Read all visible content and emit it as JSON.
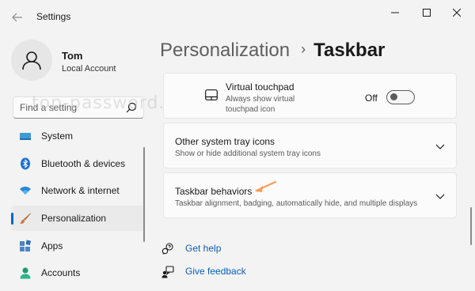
{
  "window": {
    "title": "Settings",
    "controls": [
      "minimize",
      "maximize",
      "close"
    ]
  },
  "profile": {
    "name": "Tom",
    "account_type": "Local Account"
  },
  "search": {
    "placeholder": "Find a setting"
  },
  "sidebar": {
    "items": [
      {
        "label": "System",
        "icon": "display-icon",
        "active": false
      },
      {
        "label": "Bluetooth & devices",
        "icon": "bluetooth-icon",
        "active": false
      },
      {
        "label": "Network & internet",
        "icon": "wifi-icon",
        "active": false
      },
      {
        "label": "Personalization",
        "icon": "brush-icon",
        "active": true
      },
      {
        "label": "Apps",
        "icon": "apps-icon",
        "active": false
      },
      {
        "label": "Accounts",
        "icon": "accounts-icon",
        "active": false
      }
    ]
  },
  "breadcrumb": {
    "parent": "Personalization",
    "separator": "›",
    "current": "Taskbar"
  },
  "cards": {
    "touchpad": {
      "title": "Virtual touchpad",
      "subtitle_line1": "Always show virtual",
      "subtitle_line2": "touchpad icon",
      "toggle_state": "Off",
      "toggle_on": false
    },
    "tray": {
      "title": "Other system tray icons",
      "subtitle": "Show or hide additional system tray icons"
    },
    "behaviors": {
      "title": "Taskbar behaviors",
      "subtitle": "Taskbar alignment, badging, automatically hide, and multiple displays"
    }
  },
  "help": {
    "get_help": "Get help",
    "give_feedback": "Give feedback"
  },
  "watermark": "top-password.com",
  "colors": {
    "accent": "#0067c0",
    "link": "#0a5fb4",
    "annotation_arrow": "#f4a05a",
    "background": "#f3f3f3"
  }
}
